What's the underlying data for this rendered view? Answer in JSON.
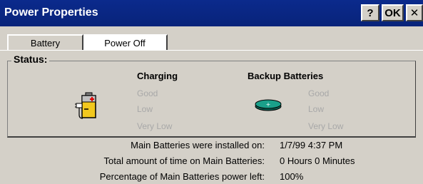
{
  "window": {
    "title": "Power Properties",
    "help_label": "?",
    "ok_label": "OK",
    "close_label": "✕"
  },
  "tabs": [
    {
      "label": "Battery",
      "active": true
    },
    {
      "label": "Power Off",
      "active": false
    }
  ],
  "status": {
    "legend": "Status:",
    "charging": {
      "heading": "Charging",
      "icon": "battery-charging-icon",
      "levels": [
        "Good",
        "Low",
        "Very Low"
      ]
    },
    "backup": {
      "heading": "Backup Batteries",
      "icon": "backup-battery-icon",
      "levels": [
        "Good",
        "Low",
        "Very Low"
      ]
    }
  },
  "info": [
    {
      "label": "Main Batteries were installed on:",
      "value": "1/7/99 4:37 PM"
    },
    {
      "label": "Total amount of time on Main Batteries:",
      "value": "0 Hours 0 Minutes"
    },
    {
      "label": "Percentage of Main Batteries power left:",
      "value": "100%"
    }
  ],
  "colors": {
    "titlebar": "#0b2a8c",
    "face": "#d4d0c8",
    "disabled_text": "#a8a8a8",
    "battery_body": "#f2c81e",
    "backup_cell": "#1aa08a"
  }
}
